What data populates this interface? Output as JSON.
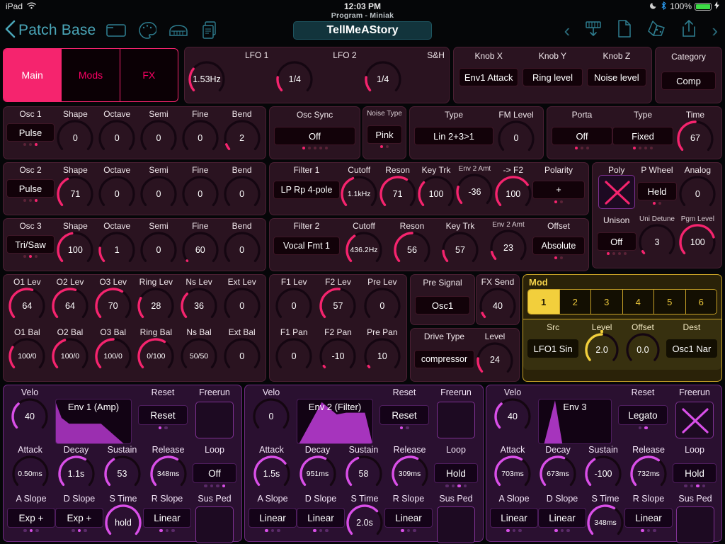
{
  "status": {
    "device": "iPad",
    "wifi_icon": "wifi-icon",
    "time": "12:03 PM",
    "moon_icon": "moon-icon",
    "bluetooth_icon": "bluetooth-icon",
    "battery_pct": "100%",
    "charging_icon": "lightning-icon"
  },
  "nav": {
    "back_label": "Patch Base",
    "back_icon": "chevron-left-icon",
    "icons": [
      "folder-icon",
      "knob-palette-icon",
      "piano-icon",
      "copy-document-icon"
    ],
    "program_sub": "Program - Miniak",
    "program_name": "TellMeAStory",
    "prev_icon": "chevron-left-icon",
    "download_icon": "download-keyboard-icon",
    "file_icon": "file-icon",
    "randomize_icon": "dice-icon",
    "share_icon": "share-upload-icon",
    "next_icon": "chevron-right-icon"
  },
  "tabs": [
    {
      "label": "Main",
      "active": true
    },
    {
      "label": "Mods",
      "active": false
    },
    {
      "label": "FX",
      "active": false
    }
  ],
  "lfo": {
    "items": [
      {
        "label": "LFO 1",
        "value": "1.53Hz",
        "pct": 0.3
      },
      {
        "label": "LFO 2",
        "value": "1/4",
        "pct": 0.18
      },
      {
        "label": "S&H",
        "value": "1/4",
        "pct": 0.18
      }
    ]
  },
  "knobs_xyz": {
    "items": [
      {
        "label": "Knob X",
        "value": "Env1 Attack"
      },
      {
        "label": "Knob Y",
        "value": "Ring level"
      },
      {
        "label": "Knob Z",
        "value": "Noise level"
      }
    ]
  },
  "category": {
    "label": "Category",
    "value": "Comp"
  },
  "osc1": {
    "title": "Osc 1",
    "wave": "Pulse",
    "dots": [
      false,
      false,
      true
    ],
    "params": [
      {
        "label": "Shape",
        "value": "0",
        "pct": 0
      },
      {
        "label": "Octave",
        "value": "0",
        "pct": 0
      },
      {
        "label": "Semi",
        "value": "0",
        "pct": 0
      },
      {
        "label": "Fine",
        "value": "0",
        "pct": 0
      },
      {
        "label": "Bend",
        "value": "2",
        "pct": 0.07
      }
    ]
  },
  "osc_sync": {
    "label": "Osc Sync",
    "value": "Off",
    "dots": [
      true,
      false,
      false,
      false,
      false
    ]
  },
  "noise_type": {
    "label": "Noise Type",
    "value": "Pink",
    "dots": [
      true,
      false
    ]
  },
  "fm": {
    "type_label": "Type",
    "type_value": "Lin 2+3>1",
    "level_label": "FM Level",
    "level_value": "0",
    "level_pct": 0
  },
  "porta": {
    "label": "Porta",
    "value": "Off",
    "dots": [
      true,
      false,
      false
    ],
    "type_label": "Type",
    "type_value": "Fixed",
    "type_dots": [
      true,
      false,
      false,
      false
    ],
    "time_label": "Time",
    "time_value": "67",
    "time_pct": 0.5
  },
  "osc2": {
    "title": "Osc 2",
    "wave": "Pulse",
    "dots": [
      false,
      false,
      true
    ],
    "params": [
      {
        "label": "Shape",
        "value": "71",
        "pct": 0.4
      },
      {
        "label": "Octave",
        "value": "0",
        "pct": 0
      },
      {
        "label": "Semi",
        "value": "0",
        "pct": 0
      },
      {
        "label": "Fine",
        "value": "0",
        "pct": 0
      },
      {
        "label": "Bend",
        "value": "0",
        "pct": 0
      }
    ]
  },
  "filter1": {
    "title": "Filter 1",
    "type": "LP Rp 4-pole",
    "params": [
      {
        "label": "Cutoff",
        "value": "1.1kHz",
        "pct": 0.42,
        "tiny": true
      },
      {
        "label": "Reson",
        "value": "71",
        "pct": 0.62
      },
      {
        "label": "Key Trk",
        "value": "100",
        "pct": 0.32
      },
      {
        "label": "Env 2 Amt",
        "value": "-36",
        "pct": 0.22,
        "small_label": true
      },
      {
        "label": "-> F2",
        "value": "100",
        "pct": 0.72
      }
    ],
    "polarity_label": "Polarity",
    "polarity_value": "+",
    "polarity_dots": [
      true,
      false
    ]
  },
  "voice": {
    "poly_label": "Poly",
    "poly_on": true,
    "pwheel_label": "P Wheel",
    "pwheel_value": "Held",
    "pwheel_dots": [
      true,
      false
    ],
    "analog_label": "Analog",
    "analog_value": "0",
    "analog_pct": 0,
    "unison_label": "Unison",
    "unison_value": "Off",
    "unison_dots": [
      true,
      false,
      false,
      false
    ],
    "detune_label": "Uni Detune",
    "detune_value": "3",
    "detune_pct": 0.03,
    "pgm_label": "Pgm Level",
    "pgm_value": "100",
    "pgm_pct": 0.78
  },
  "osc3": {
    "title": "Osc 3",
    "wave": "Tri/Saw",
    "dots": [
      false,
      true,
      false
    ],
    "params": [
      {
        "label": "Shape",
        "value": "100",
        "pct": 0.46
      },
      {
        "label": "Octave",
        "value": "1",
        "pct": 0.18
      },
      {
        "label": "Semi",
        "value": "0",
        "pct": 0
      },
      {
        "label": "Fine",
        "value": "60",
        "pct": 0.005
      },
      {
        "label": "Bend",
        "value": "0",
        "pct": 0
      }
    ]
  },
  "filter2": {
    "title": "Filter 2",
    "type": "Vocal Fmt 1",
    "params": [
      {
        "label": "Cutoff",
        "value": "436.2Hz",
        "pct": 0.37,
        "tiny": true
      },
      {
        "label": "Reson",
        "value": "56",
        "pct": 0.5
      },
      {
        "label": "Key Trk",
        "value": "57",
        "pct": 0.14
      },
      {
        "label": "Env 2 Amt",
        "value": "23",
        "pct": 0.1,
        "small_label": true
      }
    ],
    "offset_label": "Offset",
    "offset_value": "Absolute",
    "offset_dots": [
      true,
      false
    ]
  },
  "mixer": {
    "row1": [
      {
        "label": "O1 Lev",
        "value": "64",
        "pct": 0.57
      },
      {
        "label": "O2 Lev",
        "value": "64",
        "pct": 0.57
      },
      {
        "label": "O3 Lev",
        "value": "70",
        "pct": 0.62
      },
      {
        "label": "Ring Lev",
        "value": "28",
        "pct": 0.26
      },
      {
        "label": "Ns Lev",
        "value": "36",
        "pct": 0.33
      },
      {
        "label": "Ext Lev",
        "value": "0",
        "pct": 0
      }
    ],
    "row2": [
      {
        "label": "O1 Bal",
        "value": "100/0",
        "pct": 0.28,
        "tiny": true
      },
      {
        "label": "O2 Bal",
        "value": "100/0",
        "pct": 0.43,
        "tiny": true
      },
      {
        "label": "O3 Bal",
        "value": "100/0",
        "pct": 0.5,
        "tiny": true
      },
      {
        "label": "Ring Bal",
        "value": "0/100",
        "pct": 0.62,
        "tiny": true
      },
      {
        "label": "Ns Bal",
        "value": "50/50",
        "pct": 0,
        "tiny": true
      },
      {
        "label": "Ext Bal",
        "value": "0",
        "pct": 0
      }
    ]
  },
  "filtermix": {
    "row1": [
      {
        "label": "F1 Lev",
        "value": "0",
        "pct": 0
      },
      {
        "label": "F2 Lev",
        "value": "57",
        "pct": 0.52
      },
      {
        "label": "Pre Lev",
        "value": "0",
        "pct": 0
      }
    ],
    "row2": [
      {
        "label": "F1 Pan",
        "value": "0",
        "pct": 0
      },
      {
        "label": "F2 Pan",
        "value": "-10",
        "pct": 0.02
      },
      {
        "label": "Pre Pan",
        "value": "10",
        "pct": 0.02
      }
    ]
  },
  "presignal": {
    "label": "Pre Signal",
    "value": "Osc1"
  },
  "fxsend": {
    "label": "FX Send",
    "value": "40",
    "pct": 0.06
  },
  "drive": {
    "type_label": "Drive Type",
    "type_value": "compressor",
    "level_label": "Level",
    "level_value": "24",
    "level_pct": 0.18
  },
  "mod": {
    "title": "Mod",
    "slots": [
      {
        "label": "1",
        "active": true
      },
      {
        "label": "2",
        "active": false
      },
      {
        "label": "3",
        "active": false
      },
      {
        "label": "4",
        "active": false
      },
      {
        "label": "5",
        "active": false
      },
      {
        "label": "6",
        "active": false
      }
    ],
    "src_label": "Src",
    "src_value": "LFO1 Sin",
    "level_label": "Level",
    "level_value": "2.0",
    "level_pct": 0.5,
    "offset_label": "Offset",
    "offset_value": "0.0",
    "offset_pct": 0,
    "dest_label": "Dest",
    "dest_value": "Osc1 Nar"
  },
  "envelopes": [
    {
      "name": "Env 1 (Amp)",
      "shape": "amp",
      "velo_label": "Velo",
      "velo_value": "40",
      "velo_pct": 0.34,
      "reset_label": "Reset",
      "reset_value": "Reset",
      "reset_dots": [
        true,
        false
      ],
      "freerun_label": "Freerun",
      "freerun_on": false,
      "attack_label": "Attack",
      "attack_value": "0.50ms",
      "attack_pct": 0.0,
      "decay_label": "Decay",
      "decay_value": "1.1s",
      "decay_pct": 0.62,
      "sustain_label": "Sustain",
      "sustain_value": "53",
      "sustain_pct": 0.38,
      "release_label": "Release",
      "release_value": "348ms",
      "release_pct": 0.62,
      "loop_label": "Loop",
      "loop_value": "Off",
      "loop_dots": [
        false,
        false,
        false,
        true
      ],
      "aslope_label": "A Slope",
      "aslope_value": "Exp +",
      "aslope_dots": [
        false,
        true,
        false
      ],
      "dslope_label": "D Slope",
      "dslope_value": "Exp +",
      "dslope_dots": [
        false,
        true,
        false
      ],
      "stime_label": "S Time",
      "stime_value": "hold",
      "stime_pct": 1.0,
      "rslope_label": "R Slope",
      "rslope_value": "Linear",
      "rslope_dots": [
        true,
        false,
        false
      ],
      "susped_label": "Sus Ped",
      "susped_on": false
    },
    {
      "name": "Env 2 (Filter)",
      "shape": "filter",
      "velo_label": "Velo",
      "velo_value": "0",
      "velo_pct": 0,
      "reset_label": "Reset",
      "reset_value": "Reset",
      "reset_dots": [
        true,
        false
      ],
      "freerun_label": "Freerun",
      "freerun_on": false,
      "attack_label": "Attack",
      "attack_value": "1.5s",
      "attack_pct": 0.7,
      "decay_label": "Decay",
      "decay_value": "951ms",
      "decay_pct": 0.6,
      "sustain_label": "Sustain",
      "sustain_value": "58",
      "sustain_pct": 0.42,
      "release_label": "Release",
      "release_value": "309ms",
      "release_pct": 0.6,
      "loop_label": "Loop",
      "loop_value": "Hold",
      "loop_dots": [
        false,
        false,
        true,
        false
      ],
      "aslope_label": "A Slope",
      "aslope_value": "Linear",
      "aslope_dots": [
        true,
        false,
        false
      ],
      "dslope_label": "D Slope",
      "dslope_value": "Linear",
      "dslope_dots": [
        true,
        false,
        false
      ],
      "stime_label": "S Time",
      "stime_value": "2.0s",
      "stime_pct": 0.68,
      "rslope_label": "R Slope",
      "rslope_value": "Linear",
      "rslope_dots": [
        true,
        false,
        false
      ],
      "susped_label": "Sus Ped",
      "susped_on": false
    },
    {
      "name": "Env 3",
      "shape": "spike",
      "velo_label": "Velo",
      "velo_value": "40",
      "velo_pct": 0.34,
      "reset_label": "Reset",
      "reset_value": "Legato",
      "reset_dots": [
        false,
        true
      ],
      "freerun_label": "Freerun",
      "freerun_on": true,
      "attack_label": "Attack",
      "attack_value": "703ms",
      "attack_pct": 0.62,
      "decay_label": "Decay",
      "decay_value": "673ms",
      "decay_pct": 0.58,
      "sustain_label": "Sustain",
      "sustain_value": "-100",
      "sustain_pct": 0.38,
      "release_label": "Release",
      "release_value": "732ms",
      "release_pct": 0.64,
      "loop_label": "Loop",
      "loop_value": "Hold",
      "loop_dots": [
        false,
        false,
        true,
        false
      ],
      "aslope_label": "A Slope",
      "aslope_value": "Linear",
      "aslope_dots": [
        true,
        false,
        false
      ],
      "dslope_label": "D Slope",
      "dslope_value": "Linear",
      "dslope_dots": [
        true,
        false,
        false
      ],
      "stime_label": "S Time",
      "stime_value": "348ms",
      "stime_pct": 0.62,
      "rslope_label": "R Slope",
      "rslope_value": "Linear",
      "rslope_dots": [
        true,
        false,
        false
      ],
      "susped_label": "Sus Ped",
      "susped_on": false
    }
  ],
  "colors": {
    "accent_pink": "#f5246e",
    "accent_yellow": "#f2cf3c",
    "accent_purple": "#d94fe8",
    "teal": "#2e7d8f",
    "panel_bg": "#2a1320",
    "env_bg": "#2a1030"
  }
}
